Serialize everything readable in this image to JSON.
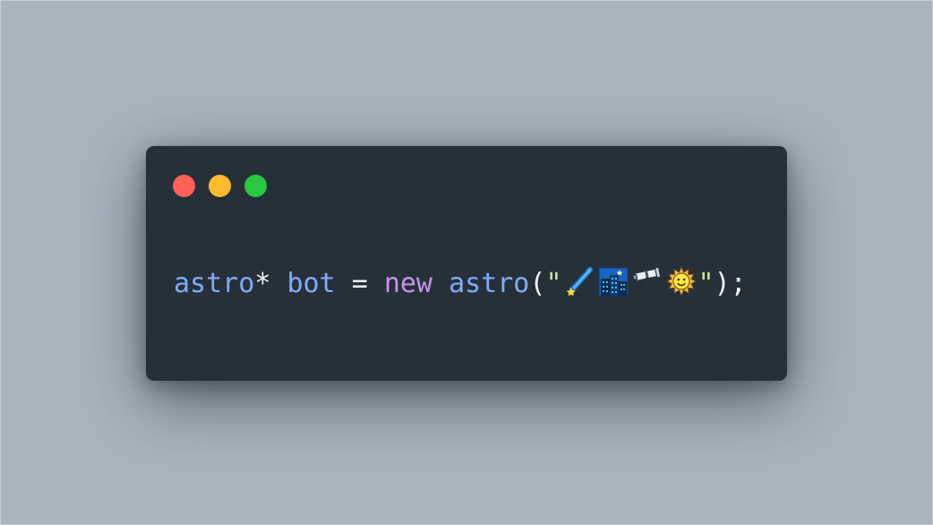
{
  "window": {
    "controls": [
      "close",
      "minimize",
      "maximize"
    ],
    "colors": {
      "background": "#263038",
      "close": "#fe5f57",
      "minimize": "#febb2e",
      "maximize": "#2ac840"
    }
  },
  "code": {
    "tokens": {
      "type": "astro",
      "pointer": "*",
      "var": "bot",
      "assign": "=",
      "keyword": "new",
      "ctor": "astro",
      "paren_open": "(",
      "quote_open": "\"",
      "quote_close": "\"",
      "paren_close": ")",
      "semicolon": ";"
    },
    "string_emojis": [
      "comet",
      "city-night",
      "telescope",
      "sun-with-face"
    ],
    "colors": {
      "identifier": "#82aaff",
      "keyword": "#c792ea",
      "string": "#c3e88d",
      "operator": "#f2f4f6"
    }
  },
  "page": {
    "background": "#a9b4bf"
  }
}
